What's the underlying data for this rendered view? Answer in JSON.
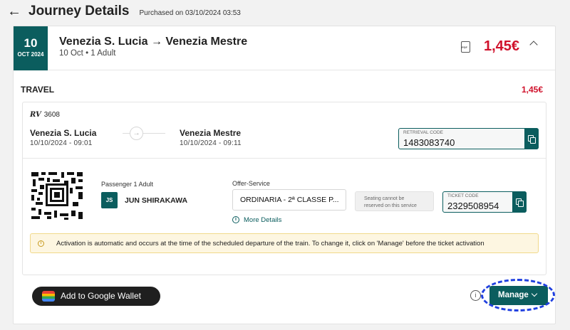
{
  "header": {
    "back_icon": "arrow-left-icon",
    "title": "Journey Details",
    "purchased": "Purchased on 03/10/2024 03:53"
  },
  "journey": {
    "date_day": "10",
    "date_month": "OCT 2024",
    "route": "Venezia S. Lucia → Venezia Mestre",
    "subtitle": "10 Oct • 1 Adult",
    "price": "1,45€",
    "icons": [
      "pdf-icon",
      "chevron-up-icon"
    ]
  },
  "travel": {
    "label": "TRAVEL",
    "price": "1,45€",
    "train_prefix": "RV",
    "train_number": "3608",
    "origin": "Venezia S. Lucia",
    "origin_time": "10/10/2024 - 09:01",
    "destination": "Venezia Mestre",
    "destination_time": "10/10/2024 - 09:11",
    "retrieval_label": "RETRIEVAL CODE",
    "retrieval_code": "1483083740"
  },
  "passenger": {
    "label": "Passenger 1 Adult",
    "initials": "JS",
    "name": "JUN SHIRAKAWA"
  },
  "offer": {
    "label": "Offer-Service",
    "value": "ORDINARIA - 2ª CLASSE P...",
    "more_details": "More Details",
    "seat_note": "Seating cannot be reserved on this service",
    "ticket_label": "TICKET CODE",
    "ticket_code": "2329508954"
  },
  "activation": {
    "text": "Activation is automatic and occurs at the time of the scheduled departure of the train. To change it, click on 'Manage' before the ticket activation"
  },
  "actions": {
    "google_wallet": "Add to Google Wallet",
    "manage": "Manage"
  },
  "colors": {
    "brand": "#0b5d5e",
    "price": "#d0112b",
    "highlight": "#1f3fe0"
  }
}
